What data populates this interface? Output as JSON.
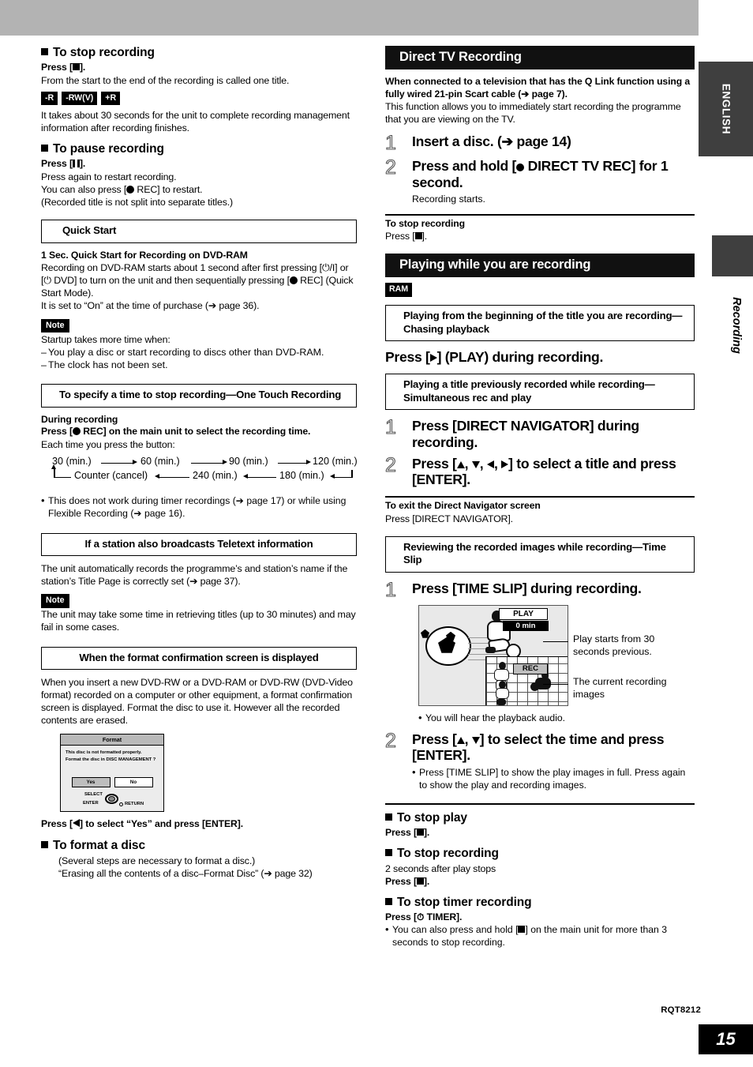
{
  "page": {
    "number": "15",
    "doc_code": "RQT8212",
    "language_tab": "ENGLISH",
    "chapter_tab": "Recording"
  },
  "left": {
    "stop_recording": {
      "heading": "To stop recording",
      "press": "Press [",
      "press_end": "].",
      "line1": "From the start to the end of the recording is called one title.",
      "disc_badges": [
        "-R",
        "-RW(V)",
        "+R"
      ],
      "line2": "It takes about 30 seconds for the unit to complete recording management information after recording finishes."
    },
    "pause_recording": {
      "heading": "To pause recording",
      "press": "Press [",
      "press_end": "].",
      "line1": "Press again to restart recording.",
      "line2_a": "You can also press [",
      "line2_b": " REC] to restart.",
      "line3": "(Recorded title is not split into separate titles.)"
    },
    "quick_start": {
      "box_title": "Quick Start",
      "subtitle": "1 Sec. Quick Start for Recording on DVD-RAM",
      "body_a": "Recording on DVD-RAM starts about 1 second after first pressing [⏻/I] or [⏻ DVD] to turn on the unit and then sequentially pressing [",
      "body_b": " REC] (Quick Start Mode).",
      "body_c": "It is set to “On” at the time of purchase (➔ page 36).",
      "note_badge": "Note",
      "note_intro": "Startup takes more time when:",
      "note_items": [
        "You play a disc or start recording to discs other than DVD-RAM.",
        "The clock has not been set."
      ]
    },
    "one_touch": {
      "box_title": "To specify a time to stop recording—One Touch Recording",
      "during": "During recording",
      "press_a": "Press [",
      "press_b": " REC] on the main unit to select the recording time.",
      "each_time": "Each time you press the button:",
      "flow_top": [
        "30 (min.)",
        "60 (min.)",
        "90 (min.)",
        "120 (min.)"
      ],
      "flow_bottom": [
        "Counter (cancel)",
        "240 (min.)",
        "180 (min.)"
      ],
      "bullet": "This does not work during timer recordings (➔ page 17) or while using Flexible Recording (➔ page 16)."
    },
    "teletext": {
      "box_title": "If a station also broadcasts Teletext information",
      "body": "The unit automatically records the programme’s and station’s name if the station’s Title Page is correctly set (➔ page 37).",
      "note_badge": "Note",
      "note_body": "The unit may take some time in retrieving titles (up to 30 minutes) and may fail in some cases."
    },
    "format_confirm": {
      "box_title": "When the format confirmation screen is displayed",
      "body": "When you insert a new DVD-RW or a DVD-RAM or DVD-RW (DVD-Video format) recorded on a computer or other equipment, a format confirmation screen is displayed. Format the disc to use it. However all the recorded contents are erased.",
      "dialog": {
        "title": "Format",
        "line1": "This disc is not formatted properly.",
        "line2": "Format the disc in DISC MANAGEMENT ?",
        "yes": "Yes",
        "no": "No",
        "select": "SELECT",
        "enter": "ENTER",
        "return": "RETURN"
      },
      "instruction_a": "Press [",
      "instruction_b": "] to select “Yes” and press [ENTER].",
      "format_disc_heading": "To format a disc",
      "format_disc_line1": "(Several steps are necessary to format a disc.)",
      "format_disc_line2": "“Erasing all the contents of a disc–Format Disc” (➔ page 32)"
    }
  },
  "right": {
    "direct_tv": {
      "banner": "Direct TV Recording",
      "intro_bold": "When connected to a television that has the Q Link function using a fully wired 21-pin Scart cable (➔ page 7).",
      "intro_body": "This function allows you to immediately start recording the programme that you are viewing on the TV.",
      "step1_num": "1",
      "step1_text": "Insert a disc. (➔ page 14)",
      "step2_num": "2",
      "step2_text_a": "Press and hold [",
      "step2_text_b": " DIRECT TV REC] for 1 second.",
      "step2_sub": "Recording starts.",
      "stop_heading": "To stop recording",
      "stop_press_a": "Press [",
      "stop_press_b": "]."
    },
    "playing_while_recording": {
      "banner": "Playing while you are recording",
      "ram_badge": "RAM",
      "chasing": {
        "box_title": "Playing from the beginning of the title you are recording—Chasing playback",
        "instruction_a": "Press [",
        "instruction_b": "] (PLAY) during recording."
      },
      "simultaneous": {
        "box_title": "Playing a title previously recorded while recording—Simultaneous rec and play",
        "step1_num": "1",
        "step1_text": "Press [DIRECT NAVIGATOR] during recording.",
        "step2_num": "2",
        "step2_text_a": "Press [",
        "step2_text_b": "] to select a title and press [ENTER].",
        "exit_heading": "To exit the Direct Navigator screen",
        "exit_body": "Press [DIRECT NAVIGATOR]."
      },
      "time_slip": {
        "box_title": "Reviewing the recorded images while recording—Time Slip",
        "step1_num": "1",
        "step1_text": "Press [TIME SLIP] during recording.",
        "figure": {
          "play_badge": "PLAY",
          "time_badge": "0 min",
          "rec_badge": "REC",
          "callout_top": "Play starts from 30 seconds previous.",
          "callout_bottom": "The current recording images"
        },
        "bullet_audio": "You will hear the playback audio.",
        "step2_num": "2",
        "step2_text_a": "Press [",
        "step2_text_b": "] to select the time and press [ENTER].",
        "step2_bullet": "Press [TIME SLIP] to show the play images in full. Press again to show the play and recording images."
      }
    },
    "stop_section": {
      "stop_play_heading": "To stop play",
      "stop_play_press_a": "Press [",
      "stop_play_press_b": "].",
      "stop_rec_heading": "To stop recording",
      "stop_rec_note": "2 seconds after play stops",
      "stop_rec_press_a": "Press [",
      "stop_rec_press_b": "].",
      "stop_timer_heading": "To stop timer recording",
      "stop_timer_press_a": "Press [⏱ TIMER].",
      "stop_timer_bullet_a": "You can also press and hold [",
      "stop_timer_bullet_b": "] on the main unit for more than 3 seconds to stop recording."
    }
  }
}
